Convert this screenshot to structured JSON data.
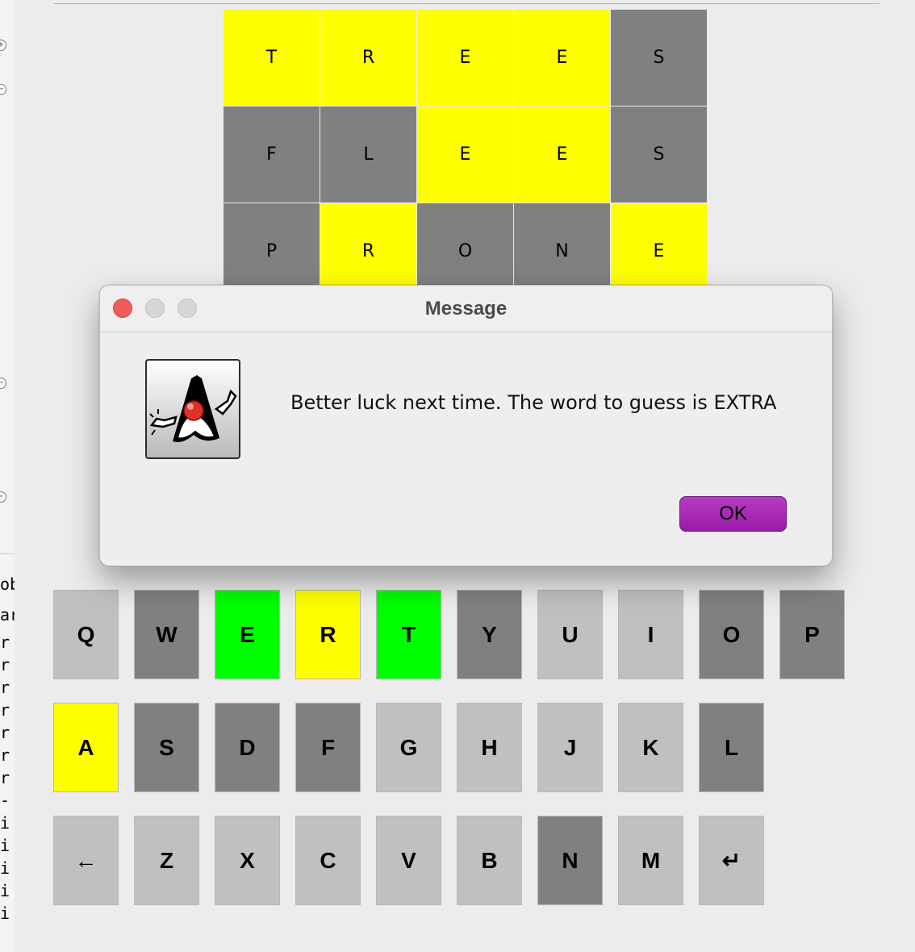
{
  "dialog": {
    "title": "Message",
    "message": "Better luck next time. The word to guess is EXTRA",
    "ok_label": "OK",
    "icon": "java-duke-icon",
    "accent_color": "#a826b5"
  },
  "grid": {
    "rows": [
      [
        {
          "letter": "T",
          "state": "yellow"
        },
        {
          "letter": "R",
          "state": "yellow"
        },
        {
          "letter": "E",
          "state": "yellow"
        },
        {
          "letter": "E",
          "state": "yellow"
        },
        {
          "letter": "S",
          "state": "gray"
        }
      ],
      [
        {
          "letter": "F",
          "state": "gray"
        },
        {
          "letter": "L",
          "state": "gray"
        },
        {
          "letter": "E",
          "state": "yellow"
        },
        {
          "letter": "E",
          "state": "yellow"
        },
        {
          "letter": "S",
          "state": "gray"
        }
      ],
      [
        {
          "letter": "P",
          "state": "gray"
        },
        {
          "letter": "R",
          "state": "yellow"
        },
        {
          "letter": "O",
          "state": "gray"
        },
        {
          "letter": "N",
          "state": "gray"
        },
        {
          "letter": "E",
          "state": "yellow"
        }
      ]
    ],
    "colors": {
      "yellow": "#ffff00",
      "gray": "#808080",
      "green": "#00c000"
    }
  },
  "keyboard": {
    "rows": [
      [
        {
          "key": "Q",
          "state": "light"
        },
        {
          "key": "W",
          "state": "dark"
        },
        {
          "key": "E",
          "state": "green"
        },
        {
          "key": "R",
          "state": "yellow"
        },
        {
          "key": "T",
          "state": "green"
        },
        {
          "key": "Y",
          "state": "dark"
        },
        {
          "key": "U",
          "state": "light"
        },
        {
          "key": "I",
          "state": "light"
        },
        {
          "key": "O",
          "state": "dark"
        },
        {
          "key": "P",
          "state": "dark"
        }
      ],
      [
        {
          "key": "A",
          "state": "yellow"
        },
        {
          "key": "S",
          "state": "dark"
        },
        {
          "key": "D",
          "state": "dark"
        },
        {
          "key": "F",
          "state": "dark"
        },
        {
          "key": "G",
          "state": "light"
        },
        {
          "key": "H",
          "state": "light"
        },
        {
          "key": "J",
          "state": "light"
        },
        {
          "key": "K",
          "state": "light"
        },
        {
          "key": "L",
          "state": "dark"
        }
      ],
      [
        {
          "key": "←",
          "state": "light",
          "name": "backspace"
        },
        {
          "key": "Z",
          "state": "light"
        },
        {
          "key": "X",
          "state": "light"
        },
        {
          "key": "C",
          "state": "light"
        },
        {
          "key": "V",
          "state": "light"
        },
        {
          "key": "B",
          "state": "light"
        },
        {
          "key": "N",
          "state": "dark"
        },
        {
          "key": "M",
          "state": "light"
        },
        {
          "key": "↵",
          "state": "light",
          "name": "enter"
        }
      ]
    ]
  },
  "editor_strip": {
    "partial_text": [
      "ob",
      "ar",
      "r",
      "r",
      "r",
      "r",
      "r",
      "r",
      "r",
      "-",
      "i",
      "i",
      "i",
      "i",
      "i"
    ]
  }
}
